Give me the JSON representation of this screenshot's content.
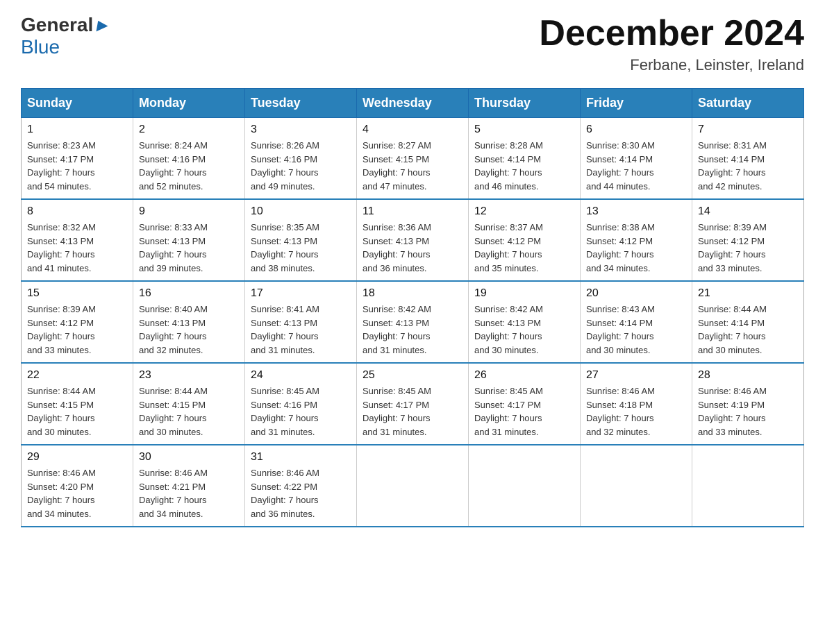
{
  "logo": {
    "general": "General",
    "arrow": "▶",
    "blue": "Blue"
  },
  "header": {
    "month": "December 2024",
    "location": "Ferbane, Leinster, Ireland"
  },
  "days_of_week": [
    "Sunday",
    "Monday",
    "Tuesday",
    "Wednesday",
    "Thursday",
    "Friday",
    "Saturday"
  ],
  "weeks": [
    [
      {
        "day": "1",
        "sunrise": "8:23 AM",
        "sunset": "4:17 PM",
        "daylight": "7 hours and 54 minutes."
      },
      {
        "day": "2",
        "sunrise": "8:24 AM",
        "sunset": "4:16 PM",
        "daylight": "7 hours and 52 minutes."
      },
      {
        "day": "3",
        "sunrise": "8:26 AM",
        "sunset": "4:16 PM",
        "daylight": "7 hours and 49 minutes."
      },
      {
        "day": "4",
        "sunrise": "8:27 AM",
        "sunset": "4:15 PM",
        "daylight": "7 hours and 47 minutes."
      },
      {
        "day": "5",
        "sunrise": "8:28 AM",
        "sunset": "4:14 PM",
        "daylight": "7 hours and 46 minutes."
      },
      {
        "day": "6",
        "sunrise": "8:30 AM",
        "sunset": "4:14 PM",
        "daylight": "7 hours and 44 minutes."
      },
      {
        "day": "7",
        "sunrise": "8:31 AM",
        "sunset": "4:14 PM",
        "daylight": "7 hours and 42 minutes."
      }
    ],
    [
      {
        "day": "8",
        "sunrise": "8:32 AM",
        "sunset": "4:13 PM",
        "daylight": "7 hours and 41 minutes."
      },
      {
        "day": "9",
        "sunrise": "8:33 AM",
        "sunset": "4:13 PM",
        "daylight": "7 hours and 39 minutes."
      },
      {
        "day": "10",
        "sunrise": "8:35 AM",
        "sunset": "4:13 PM",
        "daylight": "7 hours and 38 minutes."
      },
      {
        "day": "11",
        "sunrise": "8:36 AM",
        "sunset": "4:13 PM",
        "daylight": "7 hours and 36 minutes."
      },
      {
        "day": "12",
        "sunrise": "8:37 AM",
        "sunset": "4:12 PM",
        "daylight": "7 hours and 35 minutes."
      },
      {
        "day": "13",
        "sunrise": "8:38 AM",
        "sunset": "4:12 PM",
        "daylight": "7 hours and 34 minutes."
      },
      {
        "day": "14",
        "sunrise": "8:39 AM",
        "sunset": "4:12 PM",
        "daylight": "7 hours and 33 minutes."
      }
    ],
    [
      {
        "day": "15",
        "sunrise": "8:39 AM",
        "sunset": "4:12 PM",
        "daylight": "7 hours and 33 minutes."
      },
      {
        "day": "16",
        "sunrise": "8:40 AM",
        "sunset": "4:13 PM",
        "daylight": "7 hours and 32 minutes."
      },
      {
        "day": "17",
        "sunrise": "8:41 AM",
        "sunset": "4:13 PM",
        "daylight": "7 hours and 31 minutes."
      },
      {
        "day": "18",
        "sunrise": "8:42 AM",
        "sunset": "4:13 PM",
        "daylight": "7 hours and 31 minutes."
      },
      {
        "day": "19",
        "sunrise": "8:42 AM",
        "sunset": "4:13 PM",
        "daylight": "7 hours and 30 minutes."
      },
      {
        "day": "20",
        "sunrise": "8:43 AM",
        "sunset": "4:14 PM",
        "daylight": "7 hours and 30 minutes."
      },
      {
        "day": "21",
        "sunrise": "8:44 AM",
        "sunset": "4:14 PM",
        "daylight": "7 hours and 30 minutes."
      }
    ],
    [
      {
        "day": "22",
        "sunrise": "8:44 AM",
        "sunset": "4:15 PM",
        "daylight": "7 hours and 30 minutes."
      },
      {
        "day": "23",
        "sunrise": "8:44 AM",
        "sunset": "4:15 PM",
        "daylight": "7 hours and 30 minutes."
      },
      {
        "day": "24",
        "sunrise": "8:45 AM",
        "sunset": "4:16 PM",
        "daylight": "7 hours and 31 minutes."
      },
      {
        "day": "25",
        "sunrise": "8:45 AM",
        "sunset": "4:17 PM",
        "daylight": "7 hours and 31 minutes."
      },
      {
        "day": "26",
        "sunrise": "8:45 AM",
        "sunset": "4:17 PM",
        "daylight": "7 hours and 31 minutes."
      },
      {
        "day": "27",
        "sunrise": "8:46 AM",
        "sunset": "4:18 PM",
        "daylight": "7 hours and 32 minutes."
      },
      {
        "day": "28",
        "sunrise": "8:46 AM",
        "sunset": "4:19 PM",
        "daylight": "7 hours and 33 minutes."
      }
    ],
    [
      {
        "day": "29",
        "sunrise": "8:46 AM",
        "sunset": "4:20 PM",
        "daylight": "7 hours and 34 minutes."
      },
      {
        "day": "30",
        "sunrise": "8:46 AM",
        "sunset": "4:21 PM",
        "daylight": "7 hours and 34 minutes."
      },
      {
        "day": "31",
        "sunrise": "8:46 AM",
        "sunset": "4:22 PM",
        "daylight": "7 hours and 36 minutes."
      },
      null,
      null,
      null,
      null
    ]
  ],
  "labels": {
    "sunrise": "Sunrise:",
    "sunset": "Sunset:",
    "daylight": "Daylight:"
  }
}
